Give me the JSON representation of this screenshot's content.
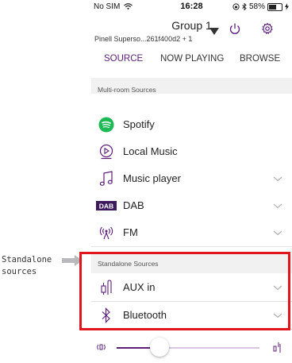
{
  "status_bar": {
    "carrier": "No SIM",
    "time": "16:28",
    "battery_percent": "58%",
    "battery_level": 0.58
  },
  "header": {
    "group_name": "Group 1",
    "subtitle": "Pinell Superso...261f400d2 + 1"
  },
  "tabs": [
    {
      "label": "SOURCE",
      "active": true
    },
    {
      "label": "NOW PLAYING",
      "active": false
    },
    {
      "label": "BROWSE",
      "active": false
    }
  ],
  "sections": {
    "multi_room": "Multi-room Sources",
    "standalone": "Standalone Sources"
  },
  "multi_room_items": [
    {
      "label": "Spotify",
      "icon": "spotify-icon",
      "has_chevron": false
    },
    {
      "label": "Local Music",
      "icon": "play-circle-icon",
      "has_chevron": false
    },
    {
      "label": "Music player",
      "icon": "music-note-icon",
      "has_chevron": true
    },
    {
      "label": "DAB",
      "icon": "dab-icon",
      "icon_text": "DAB",
      "has_chevron": true
    },
    {
      "label": "FM",
      "icon": "radio-icon",
      "has_chevron": true
    }
  ],
  "standalone_items": [
    {
      "label": "AUX in",
      "icon": "aux-plug-icon",
      "has_chevron": true
    },
    {
      "label": "Bluetooth",
      "icon": "bluetooth-icon",
      "has_chevron": true
    }
  ],
  "volume": {
    "level": 0.3
  },
  "annotation": {
    "line1": "Standalone",
    "line2": "sources"
  },
  "colors": {
    "accent": "#5b1e78",
    "highlight_box": "#e0161c",
    "spotify": "#1db954"
  }
}
